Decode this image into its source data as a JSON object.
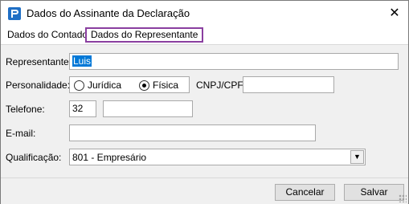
{
  "window": {
    "title": "Dados do Assinante da Declaração",
    "close_glyph": "✕",
    "icon": "app-logo-icon"
  },
  "tabs": [
    {
      "label": "Dados do Contador",
      "selected": false
    },
    {
      "label": "Dados do Representante",
      "selected": true
    }
  ],
  "form": {
    "representante_label": "Representante:",
    "representante_value": "Luis",
    "personalidade_label": "Personalidade:",
    "personalidade_options": [
      {
        "label": "Jurídica",
        "checked": false
      },
      {
        "label": "Física",
        "checked": true
      }
    ],
    "cnpj_label": "CNPJ/CPF:",
    "cnpj_value": "",
    "telefone_label": "Telefone:",
    "telefone_ddd": "32",
    "telefone_numero": "",
    "email_label": "E-mail:",
    "email_value": "",
    "qualificacao_label": "Qualificação:",
    "qualificacao_value": "801 - Empresário"
  },
  "buttons": {
    "cancel_label": "Cancelar",
    "save_label": "Salvar"
  },
  "colors": {
    "selection": "#0078d7",
    "tab_highlight": "#8a3fa0",
    "app_icon": "#1f6fc5"
  }
}
